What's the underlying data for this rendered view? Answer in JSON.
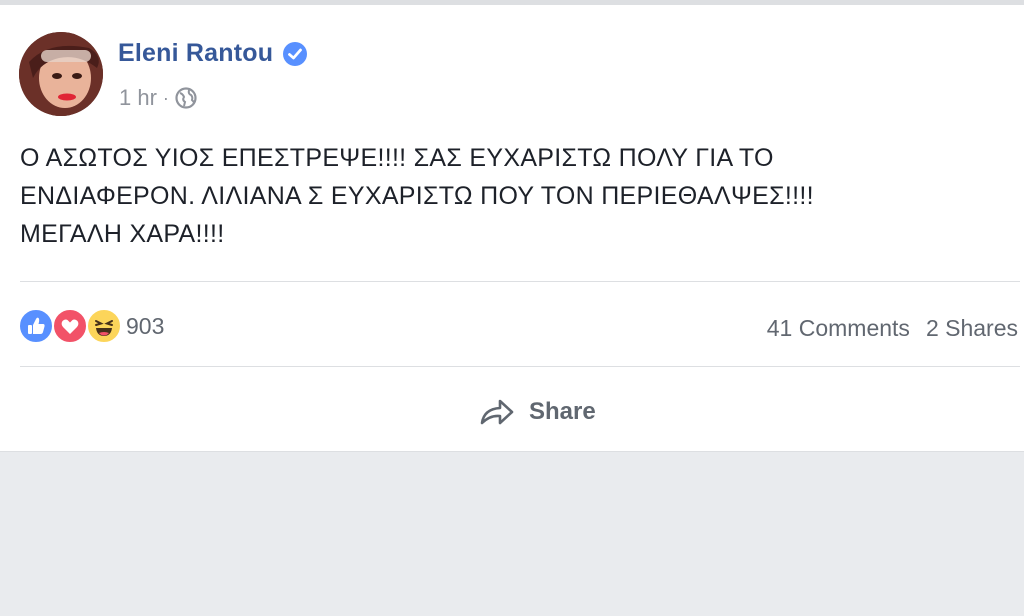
{
  "post": {
    "author": "Eleni Rantou",
    "verified_icon": "verified-badge-icon",
    "time": "1 hr",
    "separator": "·",
    "privacy_icon": "globe-icon",
    "text_lines": [
      "Ο ΑΣΩΤΟΣ ΥΙΟΣ ΕΠΕΣΤΡΕΨΕ!!!! ΣΑΣ ΕΥΧΑΡΙΣΤΩ ΠΟΛΥ ΓΙΑ ΤΟ",
      "ΕΝΔΙΑΦΕΡΟΝ. ΛΙΛΙΑΝΑ Σ ΕΥΧΑΡΙΣΤΩ ΠΟΥ ΤΟΝ ΠΕΡΙΕΘΑΛΨΕΣ!!!!",
      "ΜΕΓΑΛΗ ΧΑΡΑ!!!!"
    ]
  },
  "reactions": {
    "icons": [
      "like-icon",
      "love-icon",
      "haha-icon"
    ],
    "count": "903"
  },
  "counts": {
    "comments": "41 Comments",
    "shares": "2 Shares"
  },
  "actions": {
    "share_label": "Share"
  },
  "colors": {
    "name_link": "#365899",
    "verified": "#5890ff",
    "like": "#5890ff",
    "love": "#f25268",
    "haha": "#fcd55a",
    "page_bg": "#e9ebee"
  }
}
